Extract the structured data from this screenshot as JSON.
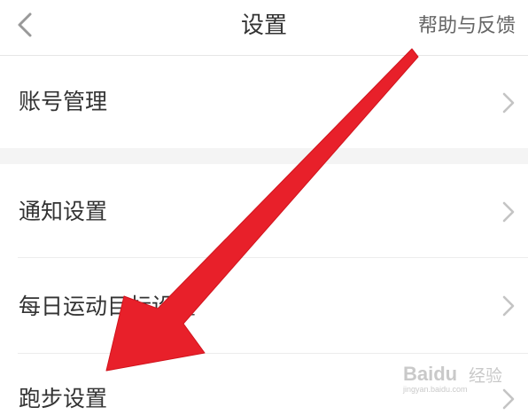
{
  "header": {
    "title": "设置",
    "help_label": "帮助与反馈"
  },
  "settings": {
    "items": [
      {
        "label": "账号管理"
      },
      {
        "label": "通知设置"
      },
      {
        "label": "每日运动目标设置"
      },
      {
        "label": "跑步设置"
      }
    ]
  },
  "icons": {
    "back": "chevron-left-icon",
    "row_chevron": "chevron-right-icon"
  },
  "watermark": {
    "brand": "Baidu",
    "sub": "经验",
    "url": "jingyan.baidu.com"
  },
  "colors": {
    "annotation_arrow": "#e8202a",
    "chevron": "#c4c4c4",
    "section_gap": "#f4f4f4"
  }
}
